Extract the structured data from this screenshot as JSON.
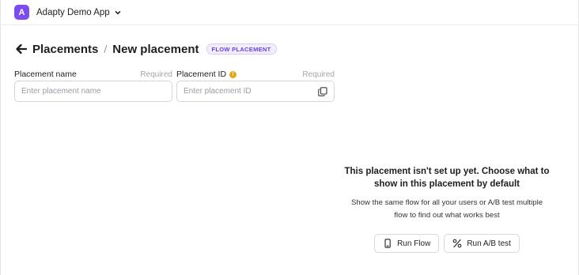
{
  "app": {
    "avatar_letter": "A",
    "name": "Adapty Demo App"
  },
  "header": {
    "root": "Placements",
    "separator": "/",
    "title": "New placement",
    "badge": "FLOW PLACEMENT"
  },
  "fields": {
    "placement_name": {
      "label": "Placement name",
      "required": "Required",
      "placeholder": "Enter placement name",
      "value": ""
    },
    "placement_id": {
      "label": "Placement ID",
      "required": "Required",
      "placeholder": "Enter placement ID",
      "value": ""
    }
  },
  "empty_state": {
    "title_line1": "This placement isn't set up yet. Choose what to",
    "title_line2": "show in this placement by default",
    "desc_line1": "Show the same flow for all your users or A/B test multiple",
    "desc_line2": "flow to find out what works best"
  },
  "buttons": {
    "run_flow": "Run Flow",
    "run_ab_test": "Run A/B test"
  },
  "icons": {
    "app_dropdown": "chevron-down-icon",
    "back": "arrow-left-icon",
    "info": "info-icon",
    "copy": "copy-icon",
    "run_flow": "phone-icon",
    "run_ab_test": "percent-icon"
  },
  "colors": {
    "accent": "#7b4cf0",
    "badge_text": "#6a3fe0",
    "info": "#e8a318"
  }
}
